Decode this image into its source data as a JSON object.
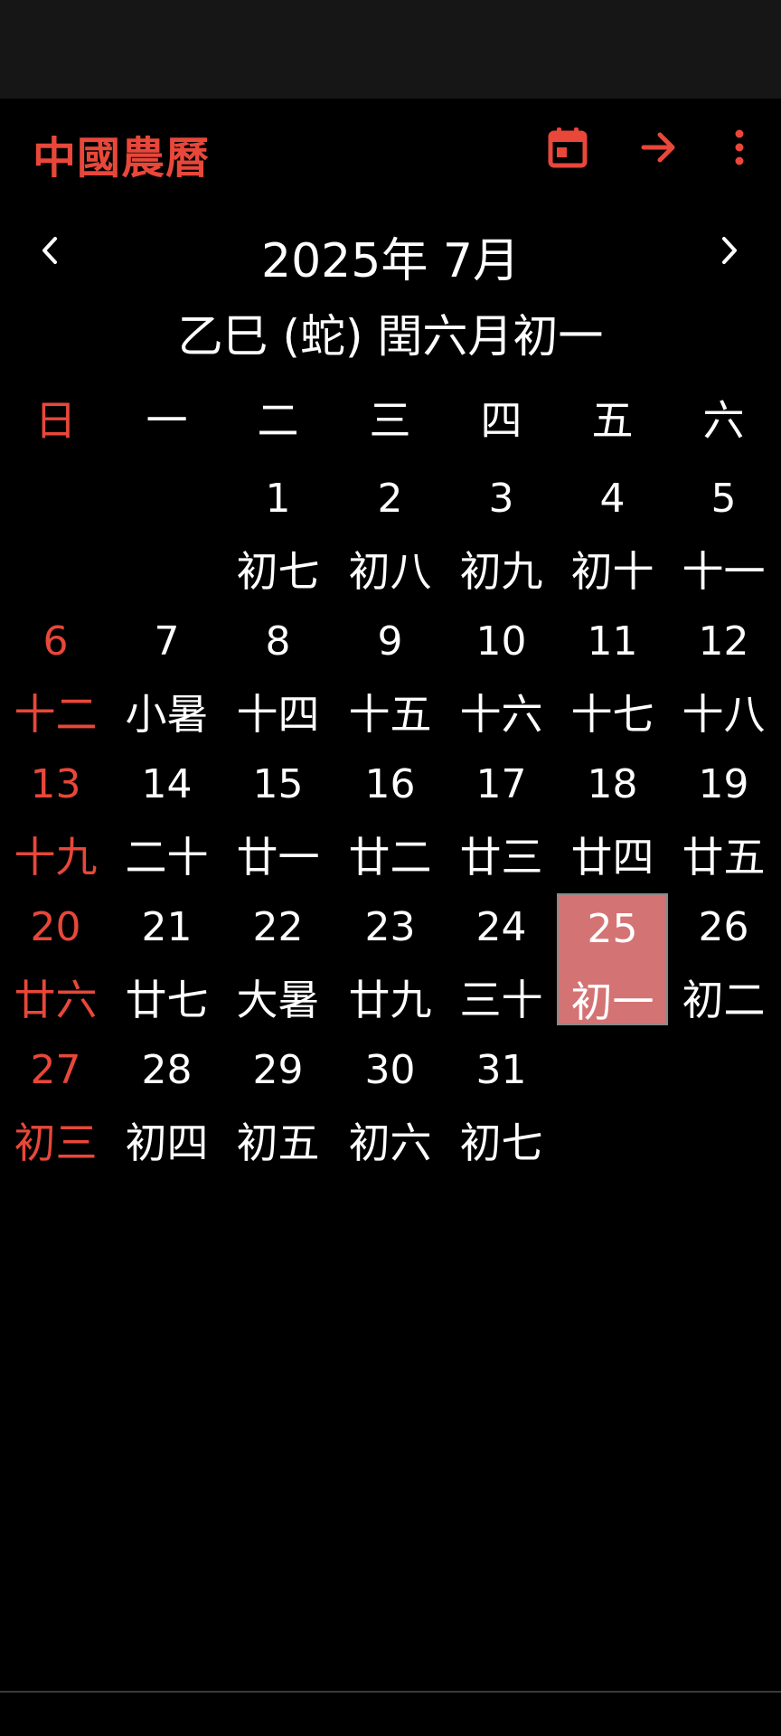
{
  "app": {
    "title": "中國農曆",
    "accent_color": "#e8473a",
    "today_highlight_color": "#d47374",
    "actions": [
      "calendar-today-icon",
      "arrow-forward-icon",
      "more-vert-icon"
    ]
  },
  "nav": {
    "prev": "‹",
    "next": "›",
    "month_title": "2025年 7月",
    "lunar_line": "乙巳 (蛇) 閏六月初一"
  },
  "weekdays": [
    "日",
    "一",
    "二",
    "三",
    "四",
    "五",
    "六"
  ],
  "weeks": [
    [
      null,
      null,
      {
        "solar": "1",
        "lunar": "初七"
      },
      {
        "solar": "2",
        "lunar": "初八"
      },
      {
        "solar": "3",
        "lunar": "初九"
      },
      {
        "solar": "4",
        "lunar": "初十"
      },
      {
        "solar": "5",
        "lunar": "十一"
      }
    ],
    [
      {
        "solar": "6",
        "lunar": "十二"
      },
      {
        "solar": "7",
        "lunar": "小暑"
      },
      {
        "solar": "8",
        "lunar": "十四"
      },
      {
        "solar": "9",
        "lunar": "十五"
      },
      {
        "solar": "10",
        "lunar": "十六"
      },
      {
        "solar": "11",
        "lunar": "十七"
      },
      {
        "solar": "12",
        "lunar": "十八"
      }
    ],
    [
      {
        "solar": "13",
        "lunar": "十九"
      },
      {
        "solar": "14",
        "lunar": "二十"
      },
      {
        "solar": "15",
        "lunar": "廿一"
      },
      {
        "solar": "16",
        "lunar": "廿二"
      },
      {
        "solar": "17",
        "lunar": "廿三"
      },
      {
        "solar": "18",
        "lunar": "廿四"
      },
      {
        "solar": "19",
        "lunar": "廿五"
      }
    ],
    [
      {
        "solar": "20",
        "lunar": "廿六"
      },
      {
        "solar": "21",
        "lunar": "廿七"
      },
      {
        "solar": "22",
        "lunar": "大暑"
      },
      {
        "solar": "23",
        "lunar": "廿九"
      },
      {
        "solar": "24",
        "lunar": "三十"
      },
      {
        "solar": "25",
        "lunar": "初一",
        "today": true
      },
      {
        "solar": "26",
        "lunar": "初二"
      }
    ],
    [
      {
        "solar": "27",
        "lunar": "初三"
      },
      {
        "solar": "28",
        "lunar": "初四"
      },
      {
        "solar": "29",
        "lunar": "初五"
      },
      {
        "solar": "30",
        "lunar": "初六"
      },
      {
        "solar": "31",
        "lunar": "初七"
      },
      null,
      null
    ]
  ]
}
